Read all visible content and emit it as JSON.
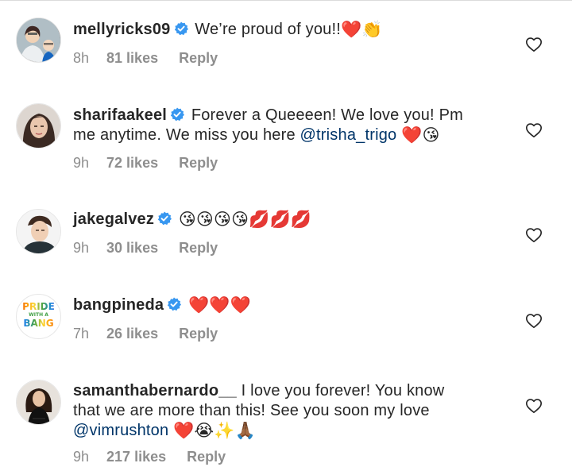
{
  "comments": [
    {
      "username": "mellyricks09",
      "text_parts": [
        "We’re proud of you!!"
      ],
      "emoji": "❤️👏",
      "time": "8h",
      "likes": "81 likes",
      "reply_label": "Reply",
      "avatar_icon": "avatar-photo-icon"
    },
    {
      "username": "sharifaakeel",
      "text_line1": "Forever a Queeeen! We love you! Pm",
      "text_line2_pre": "me anytime. We miss you here ",
      "mention": "@trisha_trigo",
      "emoji": "❤️😘",
      "time": "9h",
      "likes": "72 likes",
      "reply_label": "Reply"
    },
    {
      "username": "jakegalvez",
      "emoji": "😘😘😘😘💋💋💋",
      "time": "9h",
      "likes": "30 likes",
      "reply_label": "Reply"
    },
    {
      "username": "bangpineda",
      "emoji": "❤️❤️❤️",
      "time": "7h",
      "likes": "26 likes",
      "reply_label": "Reply",
      "avatar_text_line1": "PRIDE",
      "avatar_text_line2": "WITH A",
      "avatar_text_line3": "BANG"
    },
    {
      "username": "samanthabernardo__",
      "text_line1": "I love you forever! You know",
      "text_line2": "that we are more than this! See you soon my love",
      "mention": "@vimrushton",
      "emoji": "❤️😭✨🙏🏾",
      "time": "9h",
      "likes": "217 likes",
      "reply_label": "Reply"
    }
  ],
  "colors": {
    "text": "#262626",
    "meta": "#8e8e8e",
    "mention": "#003569",
    "verified": "#3897f0"
  }
}
